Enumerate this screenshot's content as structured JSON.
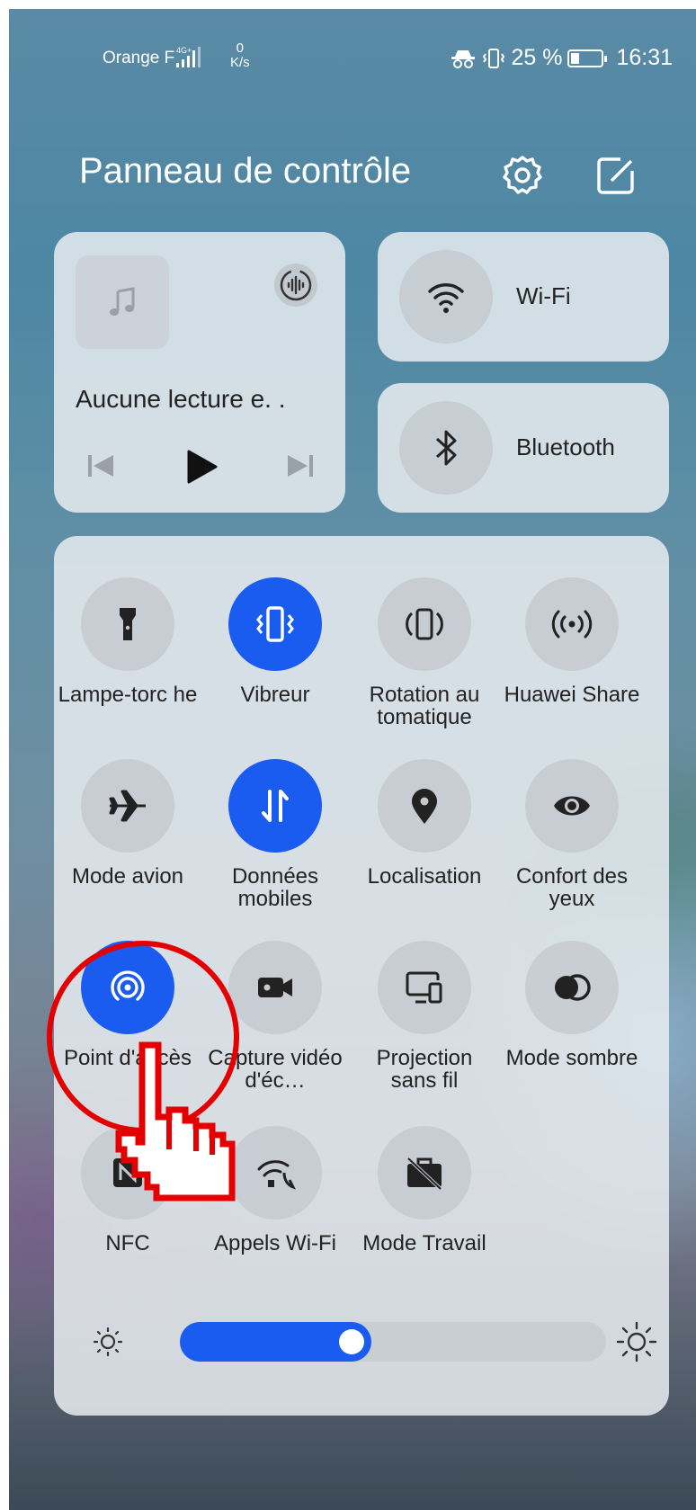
{
  "status_bar": {
    "carrier": "Orange F",
    "network": "4G+",
    "net_speed_value": "0",
    "net_speed_unit": "K/s",
    "battery": "25 %",
    "time": "16:31"
  },
  "header": {
    "title": "Panneau de contrôle",
    "settings_icon": "gear-icon",
    "edit_icon": "edit-icon"
  },
  "media": {
    "title": "Aucune lecture e. .",
    "art_icon": "music-note-icon"
  },
  "connectivity": {
    "wifi_label": "Wi-Fi",
    "bluetooth_label": "Bluetooth"
  },
  "toggles": [
    {
      "label": "Lampe-torc he",
      "icon": "flashlight-icon",
      "on": false
    },
    {
      "label": "Vibreur",
      "icon": "vibrate-icon",
      "on": true
    },
    {
      "label": "Rotation au tomatique",
      "icon": "auto-rotate-icon",
      "on": false
    },
    {
      "label": "Huawei Share",
      "icon": "huawei-share-icon",
      "on": false
    },
    {
      "label": "Mode avion",
      "icon": "airplane-icon",
      "on": false
    },
    {
      "label": "Données mobiles",
      "icon": "mobile-data-icon",
      "on": true
    },
    {
      "label": "Localisation",
      "icon": "location-icon",
      "on": false
    },
    {
      "label": "Confort des yeux",
      "icon": "eye-icon",
      "on": false
    },
    {
      "label": "Point d'accès",
      "icon": "hotspot-icon",
      "on": true
    },
    {
      "label": "Capture vidéo d'éc…",
      "icon": "screen-record-icon",
      "on": false
    },
    {
      "label": "Projection sans fil",
      "icon": "wireless-projection-icon",
      "on": false
    },
    {
      "label": "Mode sombre",
      "icon": "dark-mode-icon",
      "on": false
    },
    {
      "label": "NFC",
      "icon": "nfc-icon",
      "on": false
    },
    {
      "label": "Appels Wi-Fi",
      "icon": "wifi-calling-icon",
      "on": false
    },
    {
      "label": "Mode Travail",
      "icon": "work-mode-icon",
      "on": false
    }
  ],
  "brightness": {
    "level": 0.45
  },
  "colors": {
    "accent": "#1a5cf0",
    "annotation": "#e40000"
  }
}
